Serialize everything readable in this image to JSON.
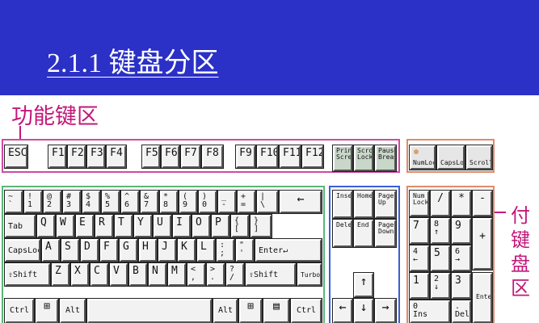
{
  "slide": {
    "title": "2.1.1 键盘分区",
    "label_function": "功能键区",
    "label_numpad_chars": [
      "付",
      "键",
      "盘",
      "区"
    ]
  },
  "colors": {
    "background": "#2b30c6",
    "function_zone": "#d04aa2",
    "main_zone": "#58b87a",
    "edit_zone": "#3a5ed8",
    "numpad_zone": "#e08a6a",
    "label_text": "#c2187a"
  },
  "keys": {
    "esc": "ESC",
    "f1": "F1",
    "f2": "F2",
    "f3": "F3",
    "f4": "F4",
    "f5": "F5",
    "f6": "F6",
    "f7": "F7",
    "f8": "F8",
    "f9": "F9",
    "f10": "F10",
    "f11": "F11",
    "f12": "F12",
    "print": "Print\nScreen",
    "scroll": "Scroll\nLock",
    "pause": "Pause\nBreak",
    "numlock_status": "NumLock",
    "capslock_status": "CapsLock",
    "scrolllock_status": "ScrollLock",
    "row1": [
      "~\n`",
      "!\n1",
      "@\n2",
      "#\n3",
      "$\n4",
      "%\n5",
      "^\n6",
      "&\n7",
      "*\n8",
      "(\n9",
      ")\n0",
      "_\n-",
      "+\n=",
      "|\n\\",
      "←"
    ],
    "row2": [
      "Tab",
      "Q",
      "W",
      "E",
      "R",
      "T",
      "Y",
      "U",
      "I",
      "O",
      "P",
      "{\n[",
      "}\n]"
    ],
    "row3": [
      "CapsLock",
      "A",
      "S",
      "D",
      "F",
      "G",
      "H",
      "J",
      "K",
      "L",
      ":\n;",
      "\"\n'",
      "Enter↵"
    ],
    "row4": [
      "⇧Shift",
      "Z",
      "X",
      "C",
      "V",
      "B",
      "N",
      "M",
      "<\n,",
      ">\n.",
      "?\n/",
      "⇧Shift",
      "Turbo"
    ],
    "row5": [
      "Ctrl",
      "⊞",
      "Alt",
      "",
      "Alt",
      "⊞",
      "▤",
      "Ctrl"
    ],
    "insert": "Insert",
    "home": "Home",
    "pageup": "Page\nUp",
    "delete": "Delete",
    "end": "End",
    "pagedown": "Page\nDown",
    "arrow_up": "↑",
    "arrow_left": "←",
    "arrow_down": "↓",
    "arrow_right": "→",
    "num_lock": "Num\nLock",
    "num_div": "/",
    "num_mul": "*",
    "num_sub": "-",
    "num_7": "7",
    "num_8": "8\n↑",
    "num_9": "9",
    "num_add": "+",
    "num_4": "4\n←",
    "num_5": "5",
    "num_6": "6\n→",
    "num_1": "1",
    "num_2": "2\n↓",
    "num_3": "3",
    "num_enter": "Enter",
    "num_0": "0\nIns",
    "num_dot": ".\nDel"
  }
}
